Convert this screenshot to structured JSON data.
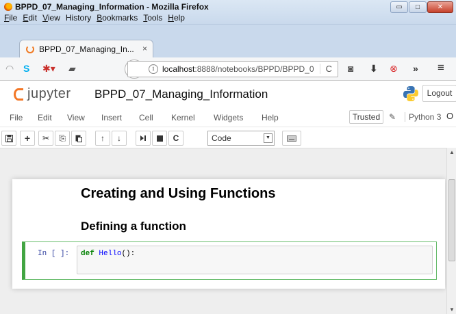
{
  "window": {
    "title": "BPPD_07_Managing_Information - Mozilla Firefox",
    "minimize_glyph": "▭",
    "maximize_glyph": "□",
    "close_glyph": "✕"
  },
  "menubar": {
    "items": [
      {
        "hotkey": "F",
        "rest": "ile"
      },
      {
        "hotkey": "E",
        "rest": "dit"
      },
      {
        "hotkey": "V",
        "rest": "iew"
      },
      {
        "hotkey": "",
        "rest": "History"
      },
      {
        "hotkey": "B",
        "rest": "ookmarks"
      },
      {
        "hotkey": "T",
        "rest": "ools"
      },
      {
        "hotkey": "H",
        "rest": "elp"
      }
    ]
  },
  "tab": {
    "title": "BPPD_07_Managing_In...",
    "close_glyph": "×"
  },
  "navbar": {
    "back_glyph": "←",
    "info_glyph": "i",
    "url_host": "localhost",
    "url_rest": ":8888/notebooks/BPPD/BPPD_0",
    "reload_glyph": "C",
    "menu_glyph": "≡",
    "overflow_glyph": "»",
    "icons": [
      "rss-icon",
      "skype-icon",
      "puzzle-icon",
      "library-icon",
      "pocket-icon",
      "download-icon",
      "noscript-icon"
    ]
  },
  "jupyter": {
    "logo_text": "jupyter",
    "notebook_name": "BPPD_07_Managing_Information",
    "logout_label": "Logout",
    "menu": [
      "File",
      "Edit",
      "View",
      "Insert",
      "Cell",
      "Kernel",
      "Widgets",
      "Help"
    ],
    "trusted_label": "Trusted",
    "kernel_name": "Python 3",
    "kernel_indicator": "O",
    "cell_type": "Code",
    "toolbar_glyphs": {
      "save": "🖫",
      "add": "+",
      "cut": "✂",
      "copy": "⎘",
      "paste": "📋",
      "up": "↑",
      "down": "↓",
      "run": "⏭",
      "stop": "■",
      "restart": "C",
      "keyboard": "⌨"
    }
  },
  "notebook": {
    "heading1": "Creating and Using Functions",
    "heading2": "Defining a function",
    "cell_prompt": "In [ ]:",
    "code_keyword": "def",
    "code_funcname": "Hello",
    "code_rest": "():"
  },
  "colors": {
    "jupyter_orange": "#f37726",
    "cell_selected_green": "#42a542",
    "code_keyword": "#008000",
    "code_function": "#0000ff",
    "prompt_blue": "#303f9f"
  }
}
